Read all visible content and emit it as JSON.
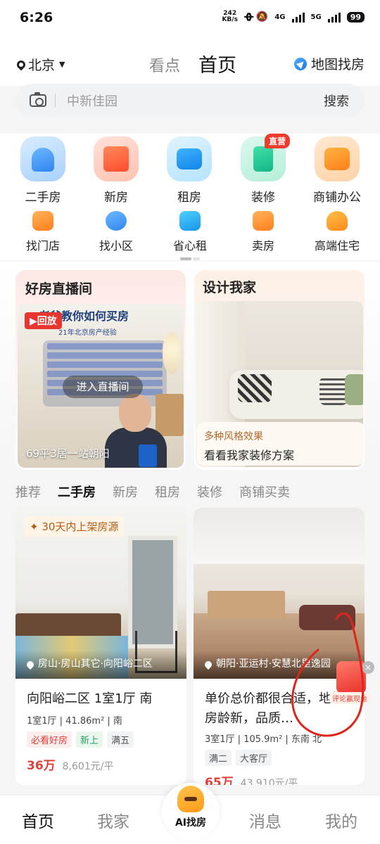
{
  "status_bar": {
    "time": "6:26",
    "net_speed_value": "242",
    "net_speed_unit": "KB/s",
    "network_1": "4G",
    "network_2": "5G",
    "battery": "99"
  },
  "header": {
    "city": "北京",
    "tabs": [
      "看点",
      "首页"
    ],
    "active_tab": "首页",
    "map_search_label": "地图找房"
  },
  "search": {
    "placeholder": "中新佳园",
    "button_label": "搜索"
  },
  "quick_entries": [
    {
      "label": "二手房",
      "icon": "house-icon",
      "color": "#2f86f0"
    },
    {
      "label": "新房",
      "icon": "building-icon",
      "color": "#ff4b2b"
    },
    {
      "label": "租房",
      "icon": "sofa-icon",
      "color": "#1186e8"
    },
    {
      "label": "装修",
      "icon": "paint-roller-icon",
      "color": "#12b786",
      "badge": "直营"
    },
    {
      "label": "商铺办公",
      "icon": "shop-icon",
      "color": "#ff7e1a"
    }
  ],
  "secondary_entries": [
    {
      "label": "找门店",
      "icon": "store-icon"
    },
    {
      "label": "找小区",
      "icon": "community-search-icon"
    },
    {
      "label": "省心租",
      "icon": "check-shield-icon"
    },
    {
      "label": "卖房",
      "icon": "tag-icon"
    },
    {
      "label": "高端住宅",
      "icon": "crown-icon"
    }
  ],
  "live_card": {
    "title": "好房直播间",
    "replay_label": "回放",
    "banner_text": "老爸教你如何买房",
    "banner_sub": "21年北京房产经验",
    "enter_label": "进入直播间",
    "caption": "69平3居一站朝阳"
  },
  "design_card": {
    "title": "设计我家",
    "subtitle": "多种风格效果",
    "caption": "看看我家装修方案"
  },
  "feed_tabs": [
    "推荐",
    "二手房",
    "新房",
    "租房",
    "装修",
    "商铺买卖"
  ],
  "feed_active": "二手房",
  "listings": [
    {
      "promo_tag": "30天内上架房源",
      "location": "房山·房山其它·向阳峪二区",
      "title": "向阳峪二区 1室1厅 南",
      "spec": "1室1厅 | 41.86m² | 南",
      "tags": [
        "必看好房",
        "新上",
        "满五"
      ],
      "total_price": "36万",
      "unit_price": "8,601元/平"
    },
    {
      "location": "朝阳·亚运村·安慧北里逸园",
      "title": "单价总价都很合适，地铁，房龄新，品质…",
      "spec": "3室1厅 | 105.9m² | 东南 北",
      "tags": [
        "满二",
        "大客厅"
      ],
      "total_price": "65万",
      "unit_price": "43,910元/平"
    }
  ],
  "review_float": {
    "label": "评论赢现金"
  },
  "tab_bar": {
    "items": [
      "首页",
      "我家",
      "消息",
      "我的"
    ],
    "center_label": "AI找房",
    "active": "首页"
  },
  "colors": {
    "accent_red": "#e0403a",
    "annotation_red": "#e0241b"
  }
}
